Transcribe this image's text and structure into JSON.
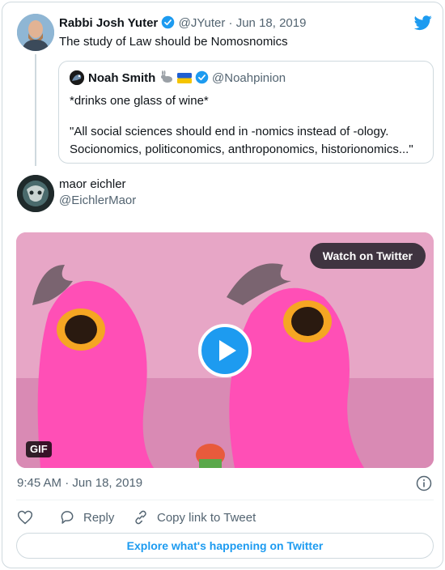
{
  "tweet": {
    "author_name": "Rabbi Josh Yuter",
    "author_handle": "@JYuter",
    "separator": "·",
    "date": "Jun 18, 2019",
    "text": "The study of Law should be Nomosnomics"
  },
  "quoted": {
    "author_name": "Noah Smith",
    "author_handle": "@Noahpinion",
    "line1": "*drinks one glass of wine*",
    "line2": "\"All social sciences should end in -nomics instead of -ology. Socionomics, politiconomics, anthroponomics, historionomics...\""
  },
  "reply": {
    "author_name": "maor eichler",
    "author_handle": "@EichlerMaor"
  },
  "media": {
    "watch_label": "Watch on Twitter",
    "gif_label": "GIF"
  },
  "meta": {
    "time": "9:45 AM",
    "separator": "·",
    "date": "Jun 18, 2019"
  },
  "actions": {
    "reply_label": "Reply",
    "copy_label": "Copy link to Tweet"
  },
  "footer": {
    "explore_label": "Explore what's happening on Twitter"
  },
  "colors": {
    "brand": "#1d9bf0",
    "muted": "#536471",
    "border": "#cfd9de"
  }
}
